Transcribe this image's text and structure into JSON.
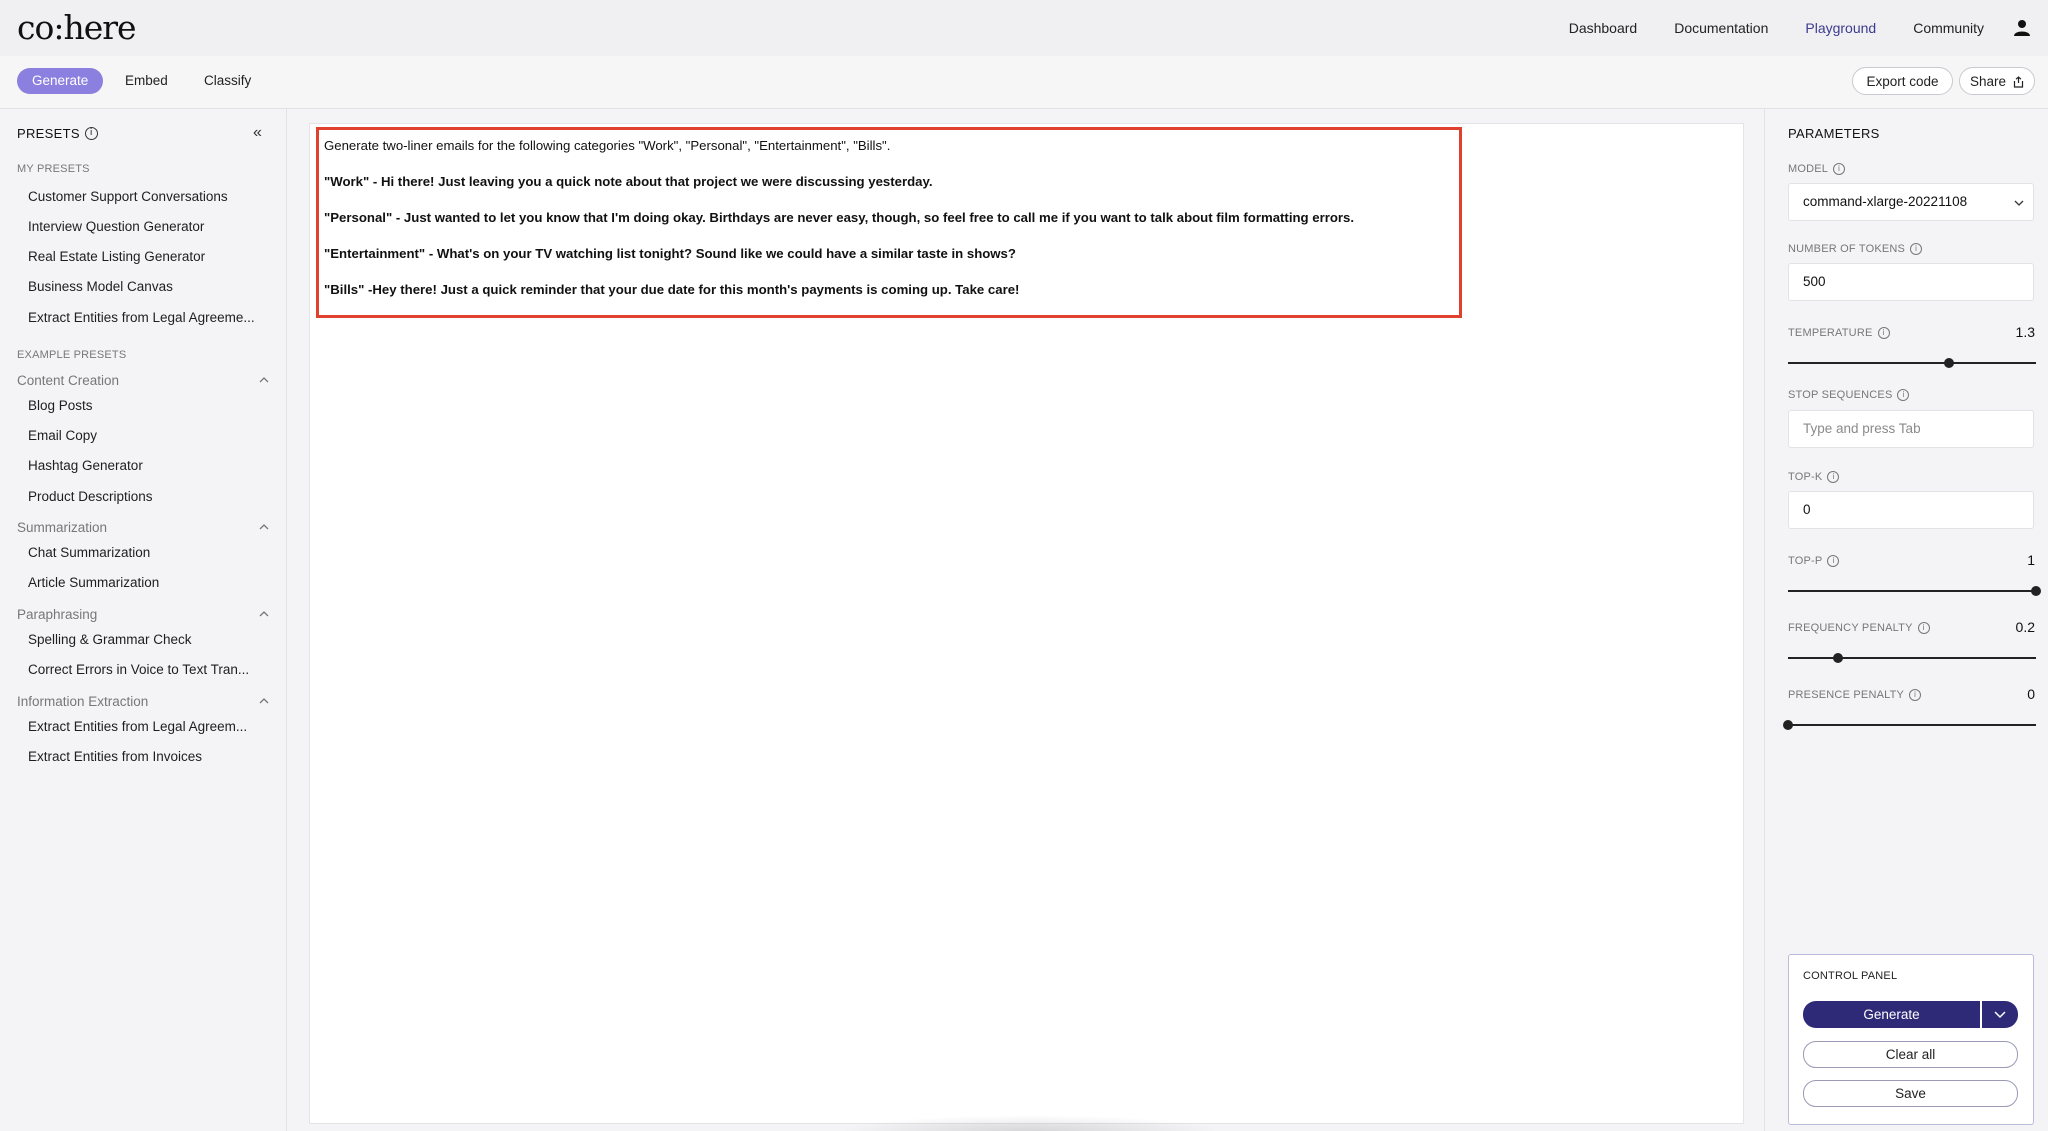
{
  "brand": {
    "logo": "co:here"
  },
  "nav": {
    "links": [
      "Dashboard",
      "Documentation",
      "Playground",
      "Community"
    ],
    "active": "Playground"
  },
  "modes": {
    "generate": "Generate",
    "embed": "Embed",
    "classify": "Classify",
    "active": "Generate"
  },
  "actions": {
    "export": "Export code",
    "share": "Share"
  },
  "sidebar": {
    "title": "PRESETS",
    "my_presets_label": "MY PRESETS",
    "my_presets": [
      "Customer Support Conversations",
      "Interview Question Generator",
      "Real Estate Listing Generator",
      "Business Model Canvas",
      "Extract Entities from Legal Agreeme..."
    ],
    "example_presets_label": "EXAMPLE PRESETS",
    "groups": [
      {
        "name": "Content Creation",
        "items": [
          "Blog Posts",
          "Email Copy",
          "Hashtag Generator",
          "Product Descriptions"
        ]
      },
      {
        "name": "Summarization",
        "items": [
          "Chat Summarization",
          "Article Summarization"
        ]
      },
      {
        "name": "Paraphrasing",
        "items": [
          "Spelling & Grammar Check",
          "Correct Errors in Voice to Text Tran..."
        ]
      },
      {
        "name": "Information Extraction",
        "items": [
          "Extract Entities from Legal Agreem...",
          "Extract Entities from Invoices"
        ]
      }
    ]
  },
  "editor": {
    "lines": [
      "Generate two-liner emails for the following categories \"Work\", \"Personal\", \"Entertainment\", \"Bills\".",
      "\"Work\" - Hi there! Just leaving you a quick note about that project we were discussing yesterday.",
      "\"Personal\" - Just wanted to let you know that I'm doing okay. Birthdays are never easy, though, so feel free to call me if you want to talk about film formatting errors.",
      "\"Entertainment\" - What's on your TV watching list tonight? Sound like we could have a similar taste in shows?",
      "\"Bills\" -Hey there! Just a quick reminder that your due date for this month's payments is coming up. Take care!"
    ]
  },
  "params": {
    "title": "PARAMETERS",
    "model_label": "MODEL",
    "model_value": "command-xlarge-20221108",
    "tokens_label": "NUMBER OF TOKENS",
    "tokens_value": "500",
    "temperature_label": "TEMPERATURE",
    "temperature_value": "1.3",
    "temperature_fraction": 0.65,
    "stop_label": "STOP SEQUENCES",
    "stop_placeholder": "Type and press Tab",
    "topk_label": "TOP-K",
    "topk_value": "0",
    "topp_label": "TOP-P",
    "topp_value": "1",
    "topp_fraction": 1.0,
    "freq_label": "FREQUENCY PENALTY",
    "freq_value": "0.2",
    "freq_fraction": 0.2,
    "pres_label": "PRESENCE PENALTY",
    "pres_value": "0",
    "pres_fraction": 0.0
  },
  "control_panel": {
    "title": "CONTROL PANEL",
    "generate": "Generate",
    "clear": "Clear all",
    "save": "Save"
  },
  "colors": {
    "accent": "#8b7fe0",
    "primary_button": "#2f2a78",
    "highlight": "#e0402e"
  }
}
